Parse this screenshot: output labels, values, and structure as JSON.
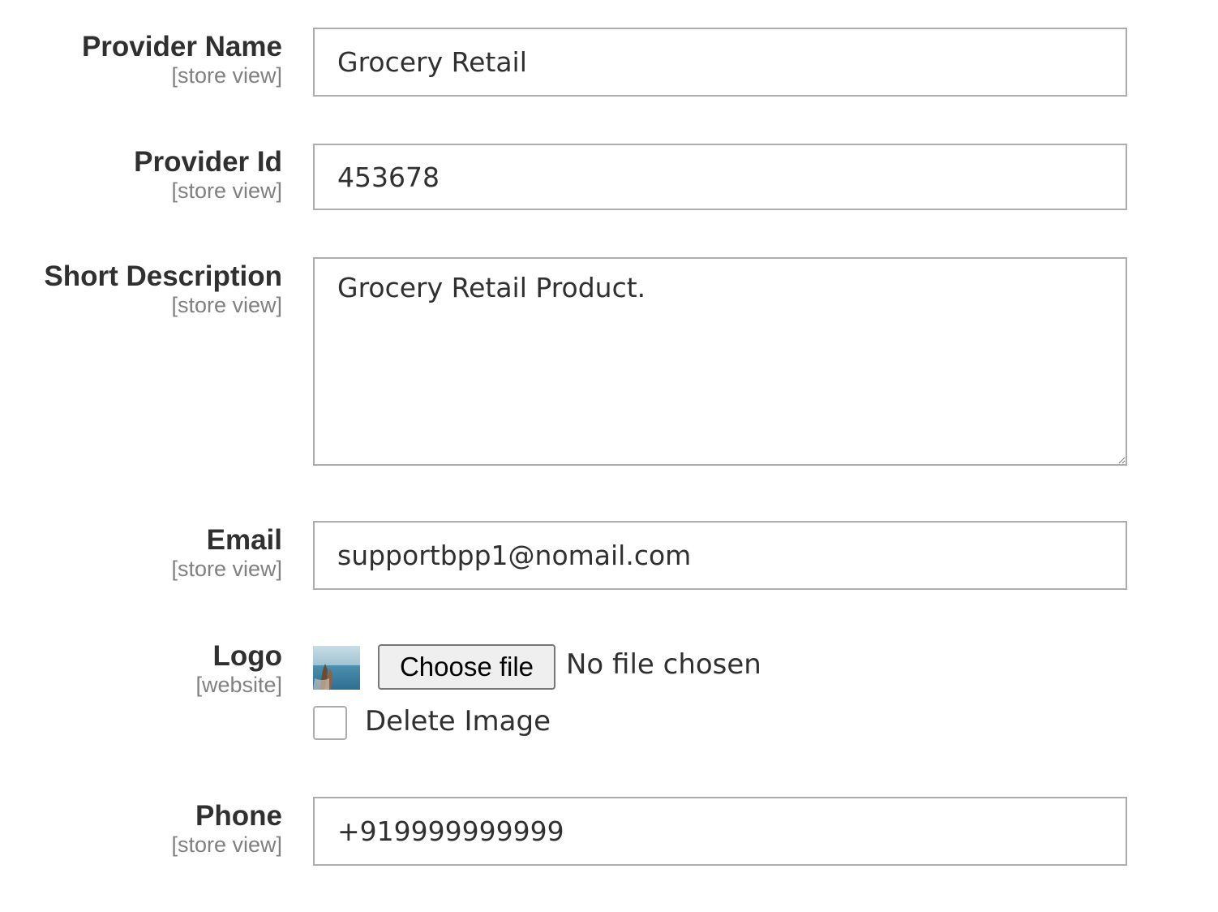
{
  "form": {
    "provider_name": {
      "label": "Provider Name",
      "scope": "[store view]",
      "value": "Grocery Retail"
    },
    "provider_id": {
      "label": "Provider Id",
      "scope": "[store view]",
      "value": "453678"
    },
    "short_description": {
      "label": "Short Description",
      "scope": "[store view]",
      "value": "Grocery Retail Product."
    },
    "email": {
      "label": "Email",
      "scope": "[store view]",
      "value": "supportbpp1@nomail.com"
    },
    "logo": {
      "label": "Logo",
      "scope": "[website]",
      "thumbnail_icon": "image-thumbnail-icon",
      "choose_file_label": "Choose file",
      "file_status": "No file chosen",
      "delete_image_label": "Delete Image",
      "delete_image_checked": false
    },
    "phone": {
      "label": "Phone",
      "scope": "[store view]",
      "value": "+919999999999"
    }
  },
  "colors": {
    "text": "#303030",
    "scope_text": "#808080",
    "field_border": "#adadad",
    "button_bg": "#efefef"
  }
}
